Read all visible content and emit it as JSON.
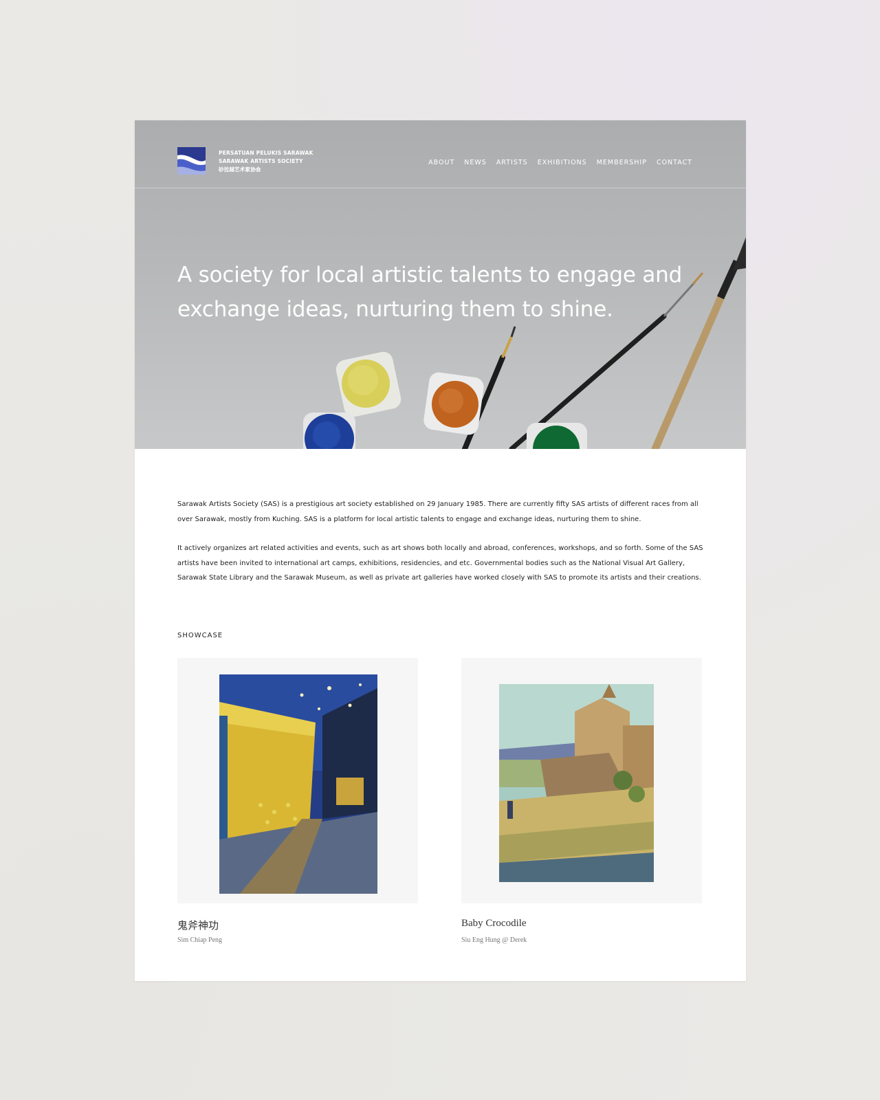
{
  "header": {
    "logo_lines": [
      "PERSATUAN PELUKIS SARAWAK",
      "SARAWAK ARTISTS SOCIETY",
      "砂拉越艺术家协会"
    ],
    "nav": [
      "ABOUT",
      "NEWS",
      "ARTISTS",
      "EXHIBITIONS",
      "MEMBERSHIP",
      "CONTACT"
    ]
  },
  "hero": {
    "title_lines": [
      "A society for local artistic talents to engage and",
      "exchange ideas, nurturing them to shine."
    ]
  },
  "intro": {
    "paragraphs": [
      "Sarawak Artists Society (SAS) is a prestigious art society established on 29 January 1985. There are currently fifty SAS artists of different races from all over Sarawak, mostly from Kuching. SAS is a platform for local artistic talents to engage and exchange ideas, nurturing them to shine.",
      "It actively organizes art related activities and events, such as art shows both locally and abroad, conferences, workshops, and so forth. Some of the SAS artists have been invited to international art camps, exhibitions, residencies, and etc. Governmental bodies such as the National Visual Art Gallery, Sarawak State Library and the Sarawak Museum, as well as private art galleries have worked closely with SAS to promote its artists and their creations."
    ]
  },
  "showcase": {
    "label": "SHOWCASE",
    "items": [
      {
        "title": "鬼斧神功",
        "artist": "Sim Chiap Peng"
      },
      {
        "title": "Baby Crocodile",
        "artist": "Siu Eng Hung @ Derek"
      }
    ]
  },
  "colors": {
    "logo_blue": "#2b3a8f",
    "hero_gray": "#b3b4b5",
    "tile_bg": "#f6f6f6"
  }
}
